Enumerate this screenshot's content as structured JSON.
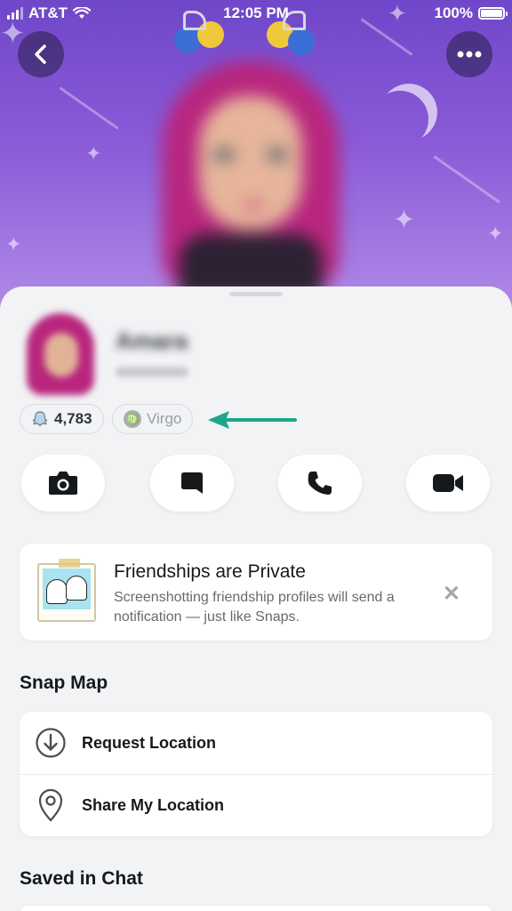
{
  "status_bar": {
    "carrier": "AT&T",
    "time": "12:05 PM",
    "battery": "100%",
    "battery_level": 1.0
  },
  "header": {
    "back_icon": "chevron-left-icon",
    "more_icon": "more-dots-icon"
  },
  "profile": {
    "display_name": "Amara",
    "snap_score": "4,783",
    "zodiac": "Virgo"
  },
  "actions": [
    {
      "name": "camera",
      "icon": "camera-icon"
    },
    {
      "name": "chat",
      "icon": "chat-bubble-icon"
    },
    {
      "name": "call",
      "icon": "phone-icon"
    },
    {
      "name": "video",
      "icon": "video-camera-icon"
    }
  ],
  "friendship_notice": {
    "title": "Friendships are Private",
    "description": "Screenshotting friendship profiles will send a notification — just like Snaps."
  },
  "snap_map": {
    "title": "Snap Map",
    "items": [
      {
        "label": "Request Location",
        "icon": "download-circle-icon"
      },
      {
        "label": "Share My Location",
        "icon": "location-pin-icon"
      }
    ]
  },
  "saved_in_chat": {
    "title": "Saved in Chat"
  },
  "colors": {
    "header_purple": "#7a4fd0",
    "accent_arrow": "#1ea58a",
    "background": "#f2f3f5"
  }
}
